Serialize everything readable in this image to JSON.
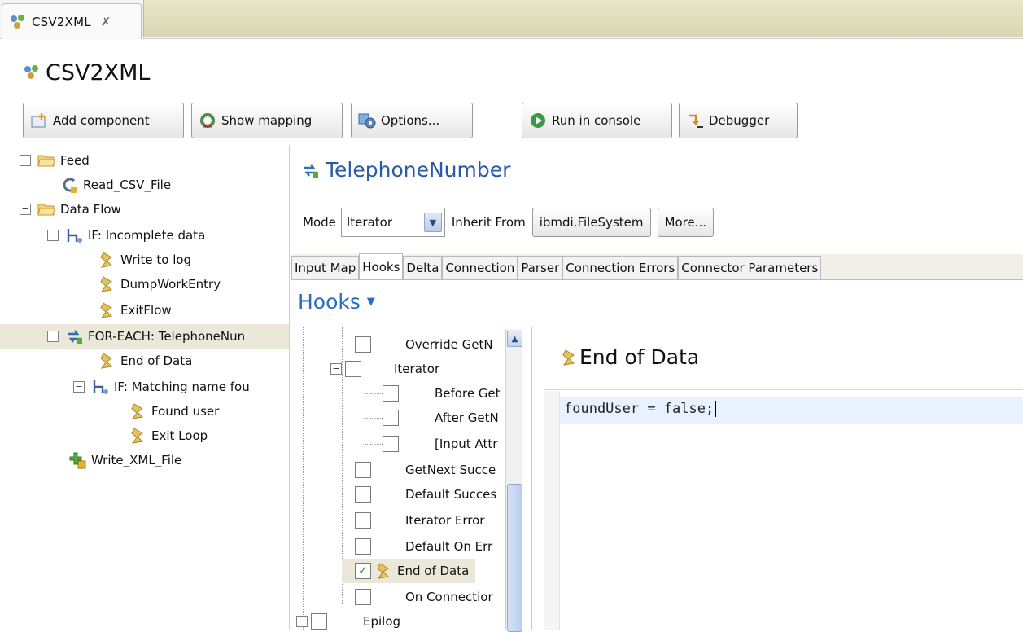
{
  "editor_tab": {
    "label": "CSV2XML",
    "close": "✗"
  },
  "header": {
    "title": "CSV2XML"
  },
  "toolbar": {
    "add_component": "Add component",
    "show_mapping": "Show mapping",
    "options": "Options...",
    "run_console": "Run in console",
    "debugger": "Debugger"
  },
  "tree": {
    "feed": "Feed",
    "read_csv": "Read_CSV_File",
    "data_flow": "Data Flow",
    "if_incomplete": "IF: Incomplete data",
    "write_log": "Write to log",
    "dump": "DumpWorkEntry",
    "exitflow": "ExitFlow",
    "foreach": "FOR-EACH: TelephoneNun",
    "end_of_data": "End of Data",
    "if_match": "IF: Matching name fou",
    "found_user": "Found user",
    "exit_loop": "Exit Loop",
    "write_xml": "Write_XML_File"
  },
  "panel": {
    "title": "TelephoneNumber",
    "mode_label": "Mode",
    "mode_value": "Iterator",
    "inherit_label": "Inherit From",
    "inherit_button": "ibmdi.FileSystem",
    "more_button": "More..."
  },
  "tabs": [
    "Input Map",
    "Hooks",
    "Delta",
    "Connection",
    "Parser",
    "Connection Errors",
    "Connector Parameters"
  ],
  "hooks_title": "Hooks",
  "hooks": {
    "override": "Override GetN",
    "iterator": "Iterator",
    "before_get": "Before Get",
    "after_get": "After GetN",
    "input_attr": "[Input Attr",
    "getnext_succ": "GetNext Succe",
    "default_succ": "Default Succes",
    "iterator_error": "Iterator Error",
    "default_onerr": "Default On Err",
    "end_of_data": "End of Data",
    "on_connection": "On Connectior",
    "epilog": "Epilog"
  },
  "editor": {
    "title": "End of Data",
    "code": "foundUser = false;"
  },
  "colors": {
    "accent_blue": "#2a5aa8",
    "hooks_blue": "#2a6cc0",
    "selection": "#ece8d9"
  }
}
